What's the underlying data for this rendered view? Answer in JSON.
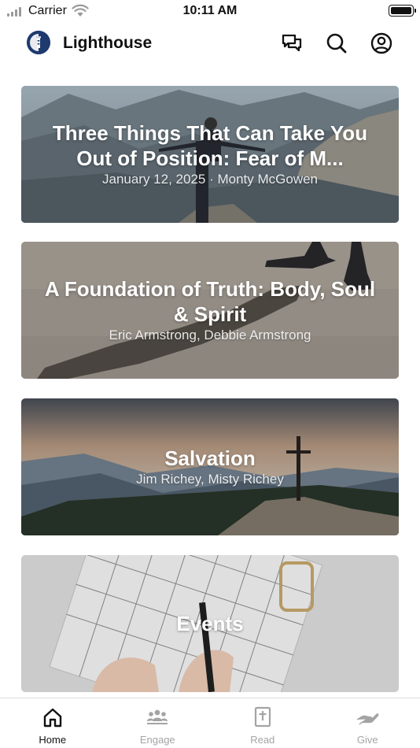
{
  "status_bar": {
    "carrier": "Carrier",
    "time": "10:11 AM"
  },
  "header": {
    "app_title": "Lighthouse",
    "logo_icon": "lighthouse-logo-icon",
    "actions": [
      {
        "icon": "chat-icon"
      },
      {
        "icon": "search-icon"
      },
      {
        "icon": "profile-icon"
      }
    ]
  },
  "cards": [
    {
      "title": "Three Things That Can Take You Out of Position: Fear of M...",
      "subtitle": "January 12, 2025 · Monty McGowen",
      "image": "man-on-mountain-image"
    },
    {
      "title": "A Foundation of Truth: Body, Soul & Spirit",
      "subtitle": "Eric Armstrong, Debbie Armstrong",
      "image": "shadow-on-gravel-image"
    },
    {
      "title": "Salvation",
      "subtitle": "Jim Richey, Misty Richey",
      "image": "cross-on-hilltop-image"
    },
    {
      "title": "Events",
      "subtitle": "",
      "image": "calendar-planner-image"
    }
  ],
  "tab_bar": {
    "active": "Home",
    "tabs": [
      {
        "label": "Home",
        "icon": "home-icon"
      },
      {
        "label": "Engage",
        "icon": "group-icon"
      },
      {
        "label": "Read",
        "icon": "bible-icon"
      },
      {
        "label": "Give",
        "icon": "give-hand-icon"
      }
    ]
  },
  "colors": {
    "active_tab": "#111111",
    "inactive_tab": "#a4a4a4",
    "logo_background": "#1e3a6e"
  }
}
